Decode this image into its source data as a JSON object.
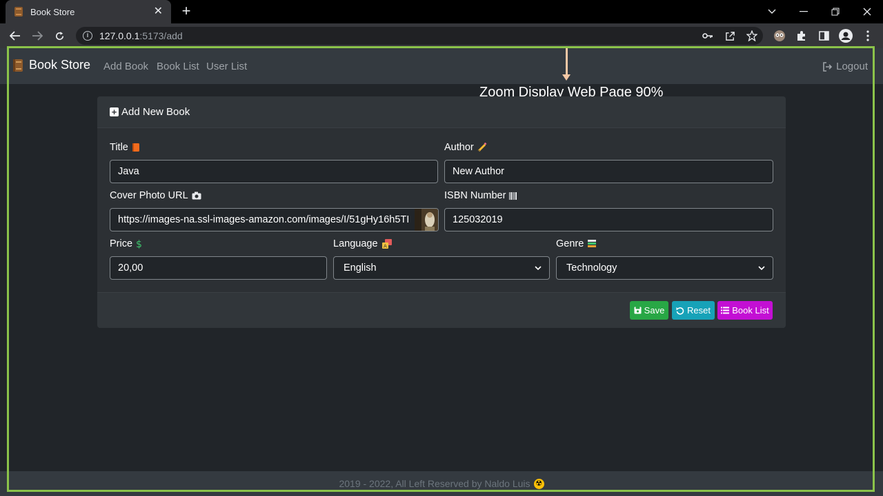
{
  "browser": {
    "tab_title": "Book Store",
    "tab_close": "✕",
    "new_tab": "+",
    "url_host": "127.0.0.1",
    "url_path": ":5173/add",
    "colors": {
      "annotation_frame": "#8bc34a"
    }
  },
  "navbar": {
    "brand": "Book Store",
    "links": [
      "Add Book",
      "Book List",
      "User List"
    ],
    "logout": "Logout"
  },
  "annotation": {
    "note": "Zoom Display Web Page 90%"
  },
  "form": {
    "header": "Add New Book",
    "title_label": "Title",
    "title_value": "Java",
    "author_label": "Author",
    "author_value": "New Author",
    "cover_label": "Cover Photo URL",
    "cover_value": "https://images-na.ssl-images-amazon.com/images/I/51gHy16h5TI",
    "isbn_label": "ISBN Number",
    "isbn_value": "125032019",
    "price_label": "Price",
    "price_value": "20,00",
    "language_label": "Language",
    "language_value": "English",
    "genre_label": "Genre",
    "genre_value": "Technology"
  },
  "buttons": {
    "save": "Save",
    "reset": "Reset",
    "book_list": "Book List",
    "colors": {
      "save": "#28a745",
      "reset": "#17a2b8",
      "book_list": "#c30fd4"
    }
  },
  "footer": {
    "text": "2019 - 2022, All Left Reserved by Naldo Luis"
  }
}
